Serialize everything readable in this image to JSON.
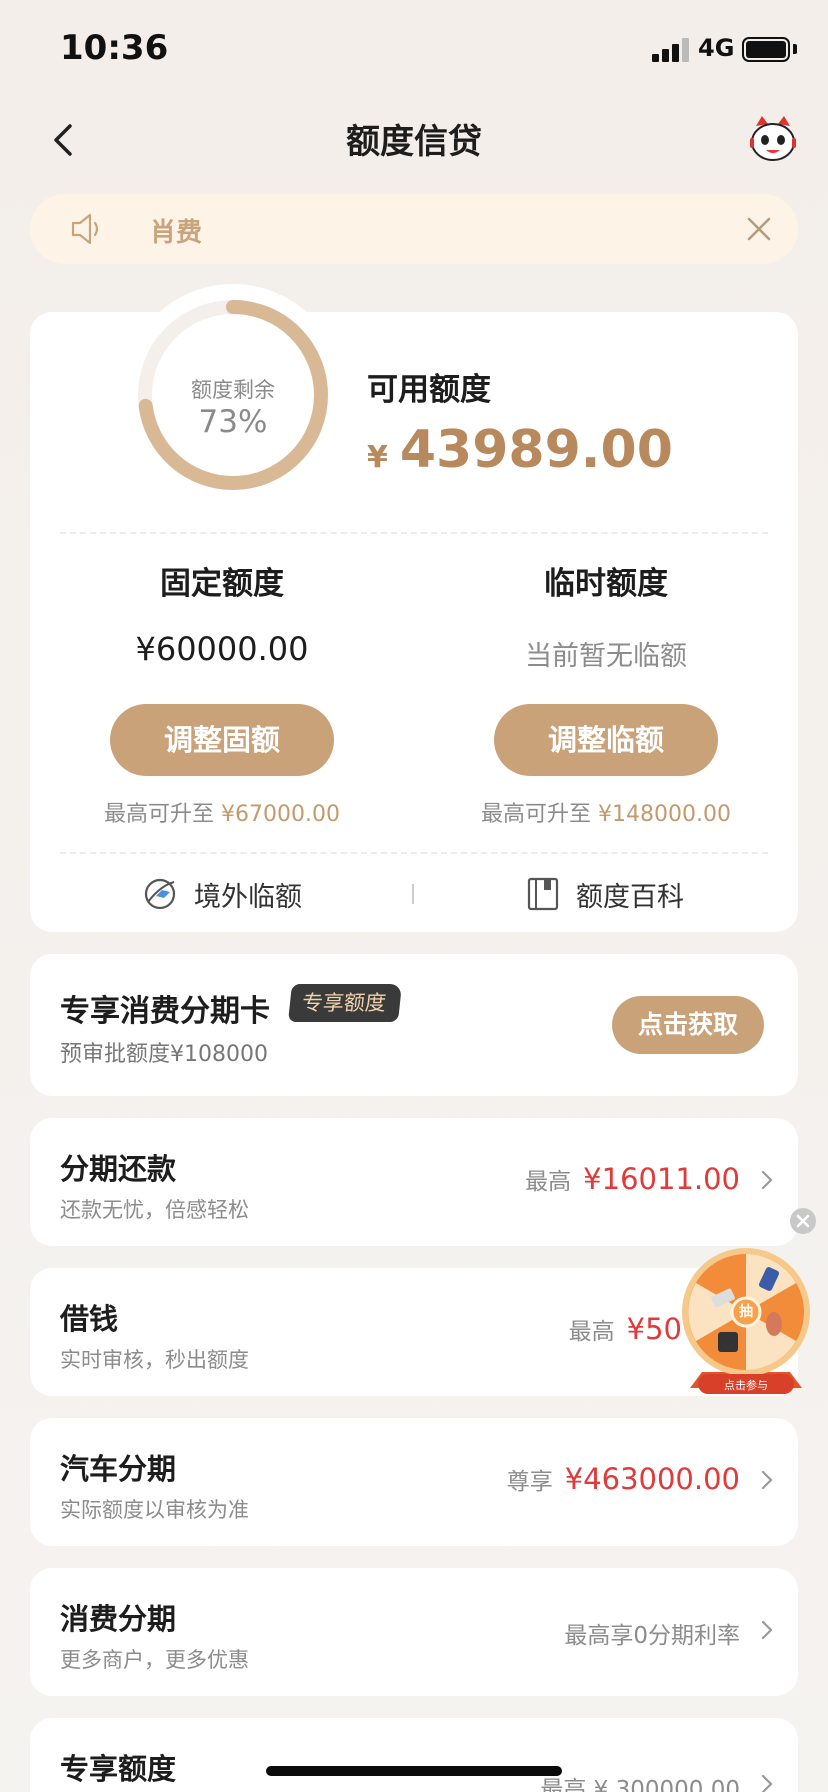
{
  "status_bar": {
    "time": "10:36",
    "network": "4G"
  },
  "nav": {
    "title": "额度信贷"
  },
  "notice": {
    "text": "肖费"
  },
  "credit": {
    "ring_label": "额度剩余",
    "remaining_percent_text": "73%",
    "remaining_fraction": 0.73,
    "available_title": "可用额度",
    "currency": "¥",
    "available_amount": "43989.00"
  },
  "fixed": {
    "title": "固定额度",
    "value": "¥60000.00",
    "button": "调整固额",
    "limit_prefix": "最高可升至",
    "limit_value": "¥67000.00"
  },
  "temp": {
    "title": "临时额度",
    "value": "当前暂无临额",
    "button": "调整临额",
    "limit_prefix": "最高可升至",
    "limit_value": "¥148000.00"
  },
  "links": {
    "overseas": "境外临额",
    "encyclopedia": "额度百科"
  },
  "promo": {
    "title": "专享消费分期卡",
    "badge": "专享额度",
    "subtitle": "预审批额度¥108000",
    "button": "点击获取"
  },
  "list": [
    {
      "title": "分期还款",
      "subtitle": "还款无忧，倍感轻松",
      "prefix": "最高",
      "amount": "¥16011.00",
      "plain": ""
    },
    {
      "title": "借钱",
      "subtitle": "实时审核，秒出额度",
      "prefix": "最高",
      "amount": "¥50",
      "plain": ""
    },
    {
      "title": "汽车分期",
      "subtitle": "实际额度以审核为准",
      "prefix": "尊享",
      "amount": "¥463000.00",
      "plain": ""
    },
    {
      "title": "消费分期",
      "subtitle": "更多商户，更多优惠",
      "prefix": "",
      "amount": "",
      "plain": "最高享0分期利率"
    },
    {
      "title": "专享额度",
      "subtitle": "",
      "prefix": "",
      "amount": "",
      "plain": "最高 ¥ 300000.00"
    }
  ],
  "wheel": {
    "center_label": "抽",
    "caption": "点击参与"
  },
  "colors": {
    "accent": "#c9a27a",
    "gold_text": "#b8895c",
    "red": "#e03a3a"
  },
  "icons": [
    "back-arrow-icon",
    "mascot-icon",
    "speaker-icon",
    "close-icon",
    "globe-plane-icon",
    "book-icon",
    "chevron-right-icon",
    "lottery-wheel-icon"
  ]
}
